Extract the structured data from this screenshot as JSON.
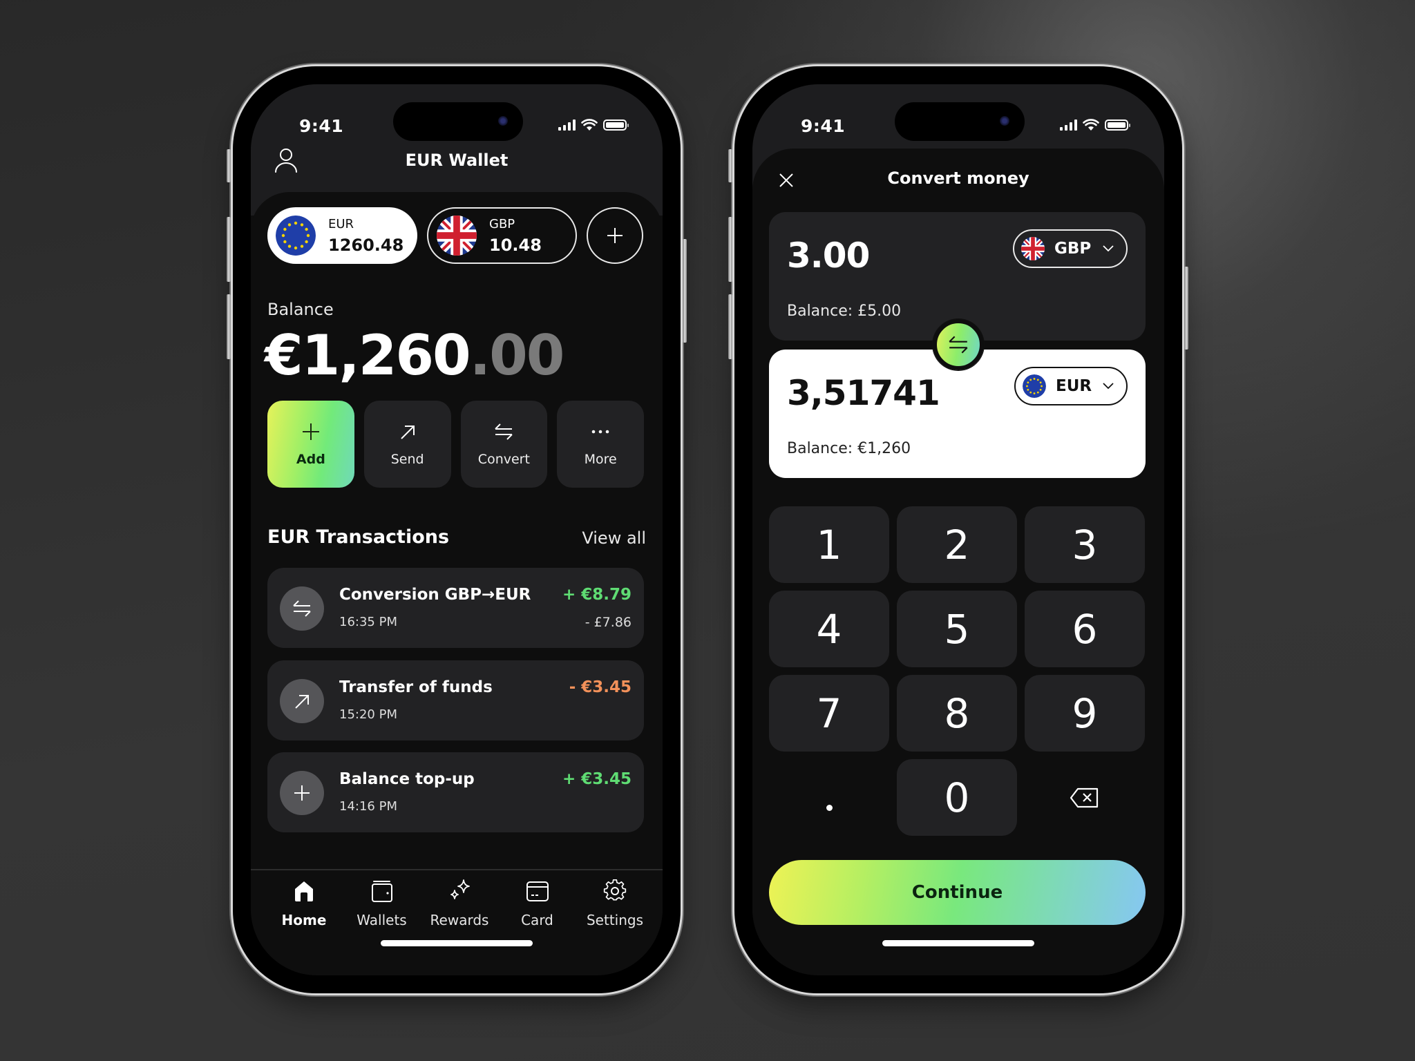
{
  "status_bar": {
    "time": "9:41"
  },
  "wallet_screen": {
    "title": "EUR Wallet",
    "chips": [
      {
        "currency": "EUR",
        "amount": "1260.48",
        "flag": "eu-flag",
        "active": true
      },
      {
        "currency": "GBP",
        "amount": "10.48",
        "flag": "uk-flag",
        "active": false
      }
    ],
    "add_wallet_icon": "plus-icon",
    "balance": {
      "label": "Balance",
      "whole": "€1,260",
      "decimal": ".00"
    },
    "actions": [
      {
        "label": "Add",
        "icon": "plus-icon"
      },
      {
        "label": "Send",
        "icon": "arrow-up-right-icon"
      },
      {
        "label": "Convert",
        "icon": "swap-arrows-icon"
      },
      {
        "label": "More",
        "icon": "more-dots-icon"
      }
    ],
    "transactions_header": "EUR Transactions",
    "view_all": "View all",
    "transactions": [
      {
        "title": "Conversion GBP→EUR",
        "time": "16:35 PM",
        "amount": "+ €8.79",
        "sub_amount": "- £7.86",
        "icon": "swap-arrows-icon",
        "amount_color": "#5fdc73"
      },
      {
        "title": "Transfer of funds",
        "time": "15:20 PM",
        "amount": "- €3.45",
        "sub_amount": "",
        "icon": "arrow-up-right-icon",
        "amount_color": "#f3915a"
      },
      {
        "title": "Balance top-up",
        "time": "14:16 PM",
        "amount": "+ €3.45",
        "sub_amount": "",
        "icon": "plus-icon",
        "amount_color": "#5fdc73"
      }
    ],
    "nav": [
      {
        "label": "Home",
        "icon": "home-icon",
        "active": true
      },
      {
        "label": "Wallets",
        "icon": "wallet-icon",
        "active": false
      },
      {
        "label": "Rewards",
        "icon": "sparkles-icon",
        "active": false
      },
      {
        "label": "Card",
        "icon": "card-icon",
        "active": false
      },
      {
        "label": "Settings",
        "icon": "gear-icon",
        "active": false
      }
    ]
  },
  "convert_screen": {
    "title": "Convert money",
    "from": {
      "amount": "3.00",
      "currency": "GBP",
      "balance": "Balance: £5.00"
    },
    "to": {
      "amount": "3,51741",
      "currency": "EUR",
      "balance": "Balance: €1,260"
    },
    "keypad": [
      "1",
      "2",
      "3",
      "4",
      "5",
      "6",
      "7",
      "8",
      "9",
      ".",
      "0",
      "backspace"
    ],
    "continue_label": "Continue"
  },
  "colors": {
    "positive": "#5fdc73",
    "negative": "#f3915a",
    "gradient": [
      "#eef255",
      "#79e87d",
      "#86c7f2"
    ],
    "card_bg": "#222224",
    "screen_bg": "#0e0e0e"
  }
}
